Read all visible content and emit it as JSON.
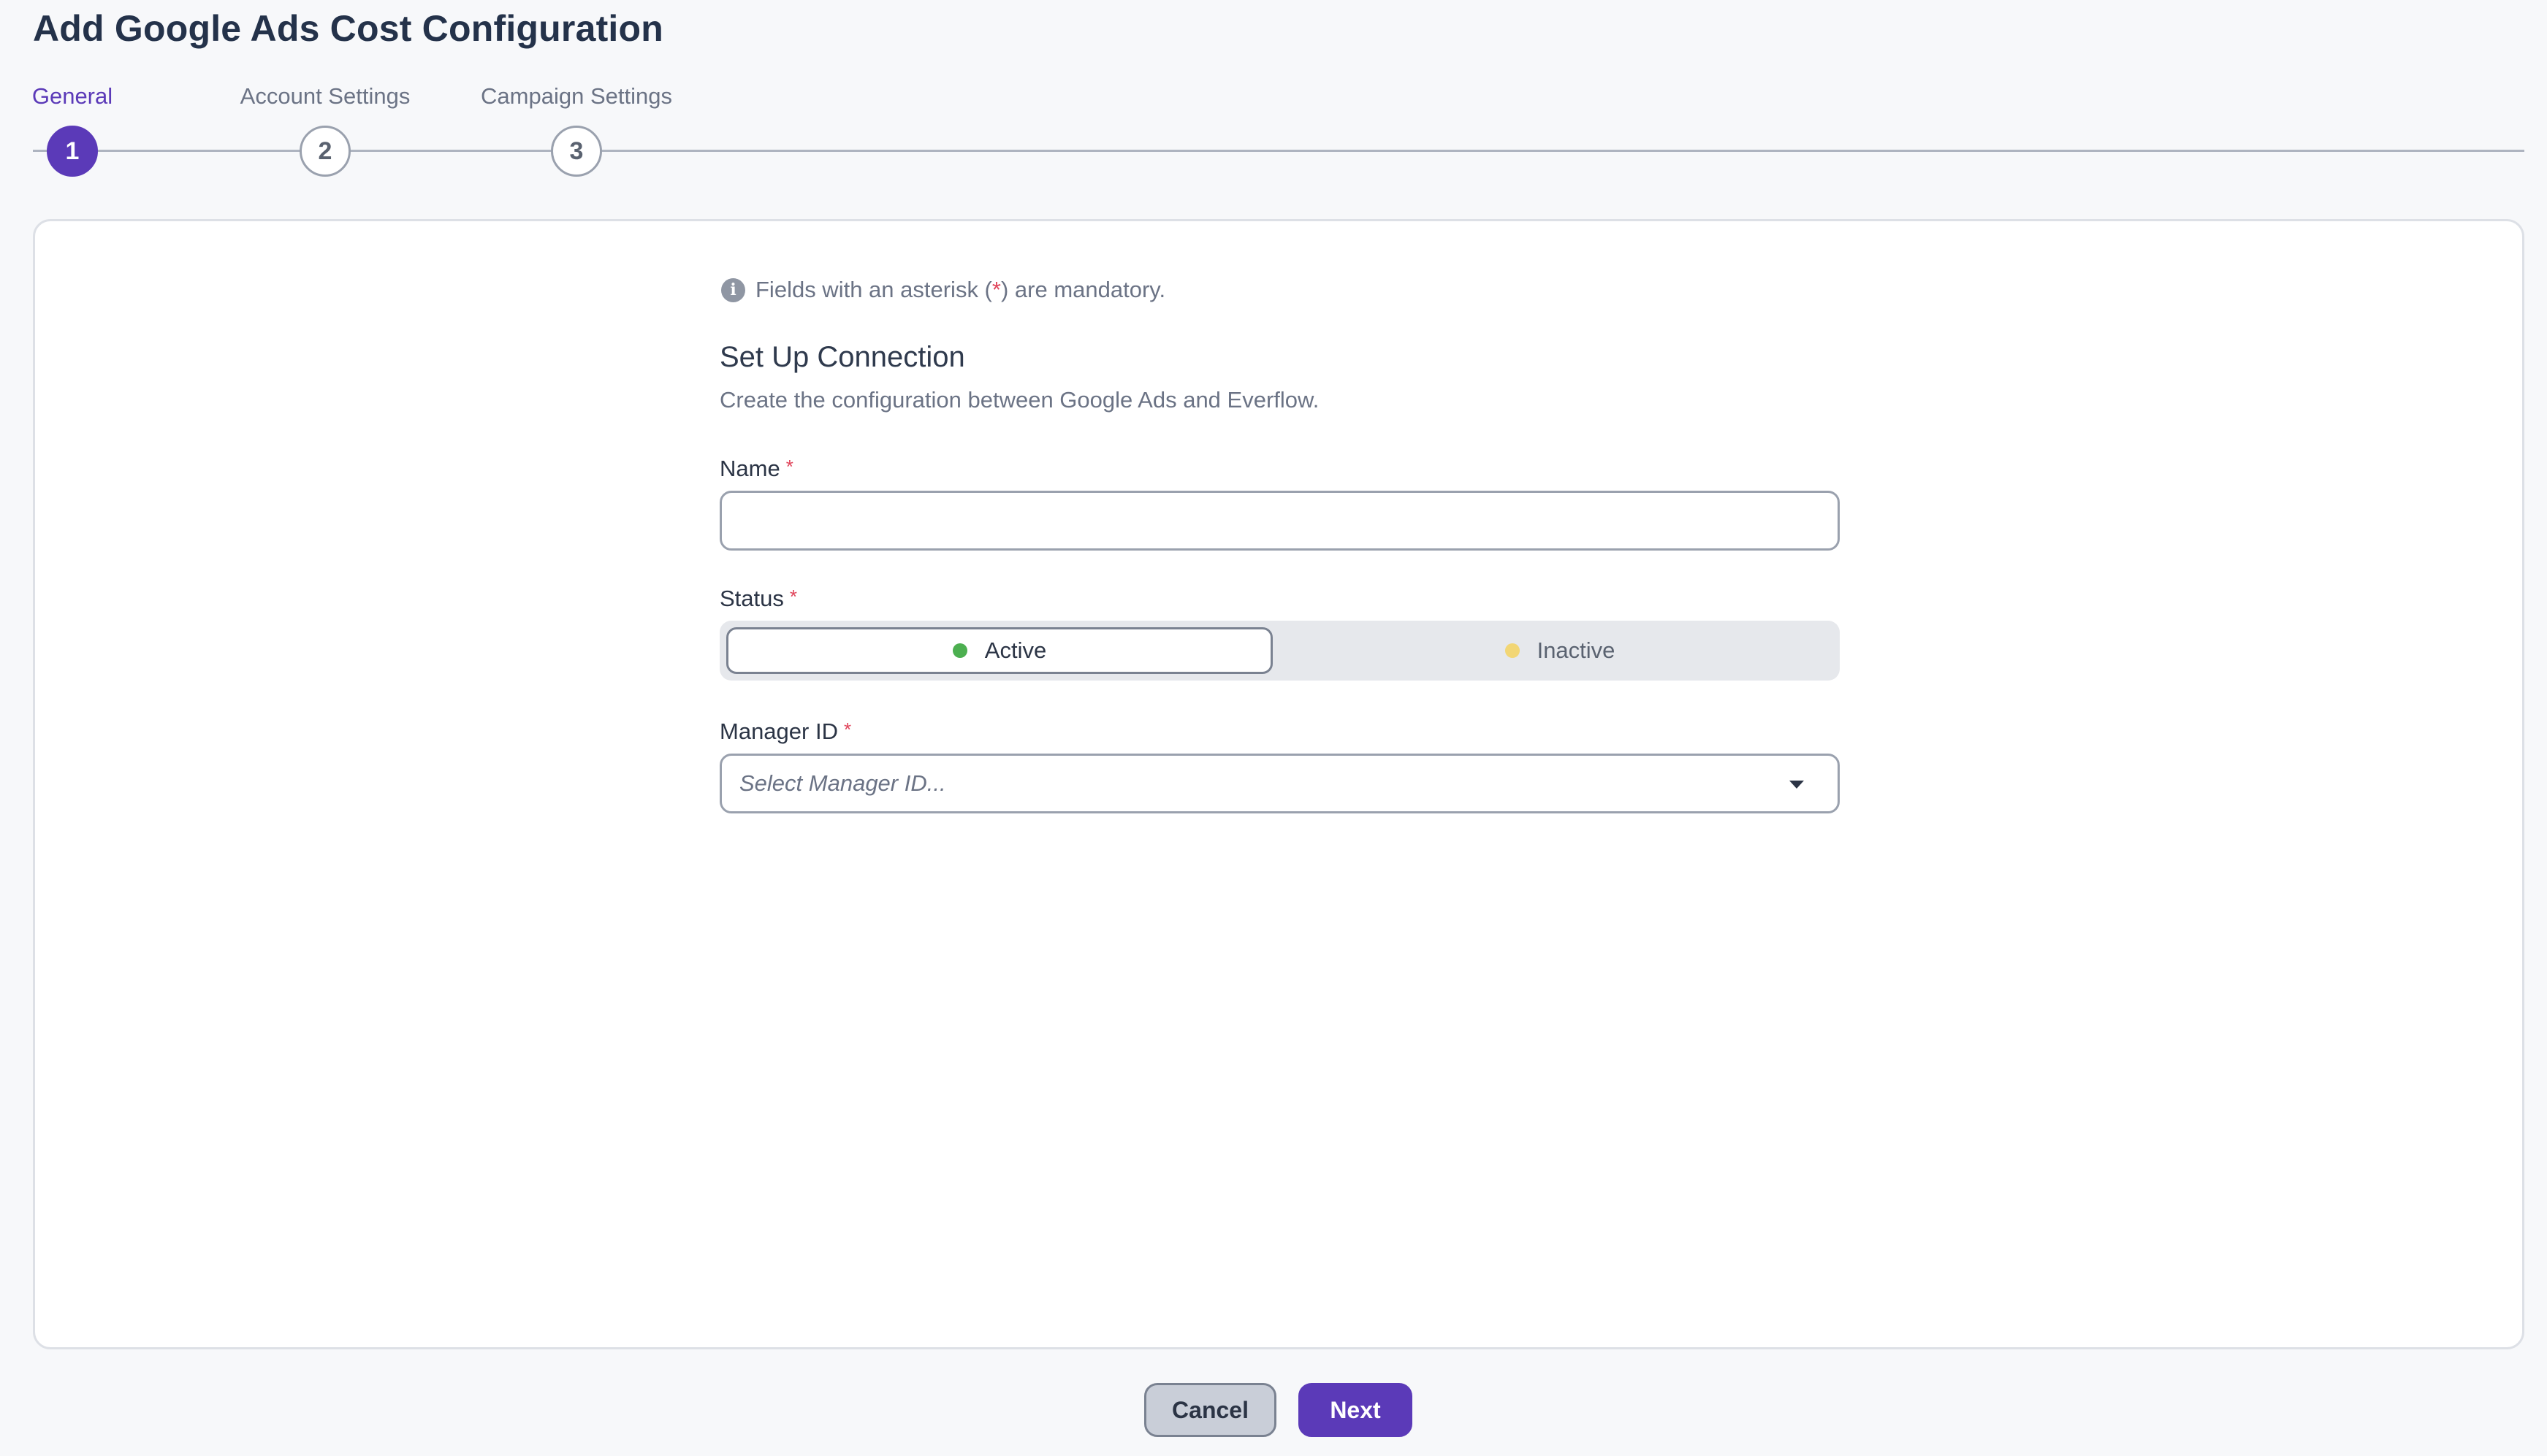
{
  "page": {
    "title": "Add Google Ads Cost Configuration"
  },
  "stepper": {
    "steps": [
      {
        "label": "General",
        "number": "1",
        "active": true
      },
      {
        "label": "Account Settings",
        "number": "2",
        "active": false
      },
      {
        "label": "Campaign Settings",
        "number": "3",
        "active": false
      }
    ]
  },
  "form": {
    "notice": {
      "prefix": "Fields with an asterisk (",
      "star": "*",
      "suffix": ") are mandatory."
    },
    "section_title": "Set Up Connection",
    "section_description": "Create the configuration between Google Ads and Everflow.",
    "required_marker": "*",
    "name": {
      "label": "Name",
      "value": ""
    },
    "status": {
      "label": "Status",
      "options": [
        {
          "label": "Active",
          "color": "#4caf50",
          "selected": true
        },
        {
          "label": "Inactive",
          "color": "#f2d675",
          "selected": false
        }
      ]
    },
    "manager_id": {
      "label": "Manager ID",
      "placeholder": "Select Manager ID..."
    }
  },
  "footer": {
    "cancel_label": "Cancel",
    "next_label": "Next"
  },
  "colors": {
    "accent": "#5b3ab8",
    "required": "#e0445a"
  },
  "icons": {
    "info": "info-icon",
    "dropdown": "chevron-down-icon"
  }
}
